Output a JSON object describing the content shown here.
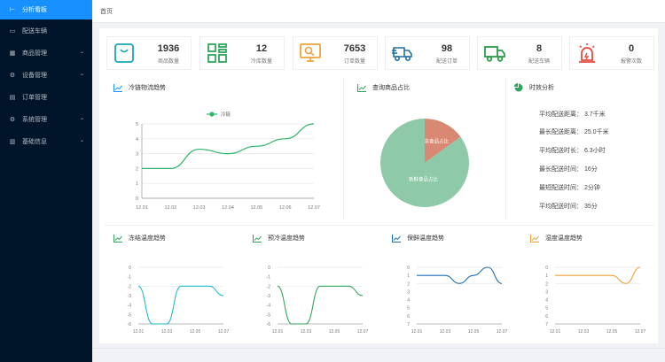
{
  "sidebar": {
    "items": [
      {
        "label": "分析看板",
        "icon": "dashboard-icon"
      },
      {
        "label": "配送车辆",
        "icon": "truck-icon"
      },
      {
        "label": "商品管理",
        "icon": "goods-icon",
        "expandable": true
      },
      {
        "label": "设备管理",
        "icon": "device-icon",
        "expandable": true
      },
      {
        "label": "订单管理",
        "icon": "order-icon"
      },
      {
        "label": "系统管理",
        "icon": "system-icon",
        "expandable": true
      },
      {
        "label": "基础信息",
        "icon": "info-icon",
        "expandable": true
      }
    ]
  },
  "breadcrumb": "首页",
  "stats": [
    {
      "value": "1936",
      "label": "商品数量",
      "icon": "shopping-bag-icon",
      "color": "#1aa7b8"
    },
    {
      "value": "12",
      "label": "冷库数量",
      "icon": "grid-icon",
      "color": "#2fa65c"
    },
    {
      "value": "7653",
      "label": "订单数量",
      "icon": "monitor-icon",
      "color": "#f0a23b"
    },
    {
      "value": "98",
      "label": "配送订单",
      "icon": "delivery-truck-icon",
      "color": "#1e6fa8"
    },
    {
      "value": "8",
      "label": "配送车辆",
      "icon": "lorry-icon",
      "color": "#2c9d47"
    },
    {
      "value": "0",
      "label": "报警次数",
      "icon": "alarm-icon",
      "color": "#e8493b"
    }
  ],
  "panels": {
    "main_chart_title": "冷链物流趋势",
    "pie_title": "查询商品占比",
    "analysis_title": "时效分析",
    "small_chart_titles": [
      "冻结温度趋势",
      "预冷温度趋势",
      "保鲜温度趋势",
      "湿度温度趋势"
    ]
  },
  "analysis": [
    "平均配送距离：  3.7千米",
    "最长配送距离：  25.0千米",
    "平均配送时长：  6.3小时",
    "最长配送时间：  16分",
    "最短配送时间：  2分钟",
    "平均配送时间：  35分"
  ],
  "colors": {
    "sidebar_bg": "#001529",
    "active": "#1890ff",
    "pie_major": "#8ec9a9",
    "pie_minor": "#d98873"
  },
  "chart_data": [
    {
      "type": "line",
      "title": "冷链物流趋势",
      "legend": [
        "冷链"
      ],
      "legend_position": "top-center",
      "categories": [
        "12.01",
        "12.02",
        "12.03",
        "12.04",
        "12.05",
        "12.06",
        "12.07"
      ],
      "series": [
        {
          "name": "冷链",
          "values": [
            2,
            2,
            3.3,
            3,
            3.5,
            4,
            5
          ],
          "color": "#2ab866"
        }
      ],
      "ylim": [
        0,
        5
      ],
      "yticks": [
        "0",
        "1",
        "2",
        "3",
        "4",
        "5"
      ],
      "grid": true
    },
    {
      "type": "pie",
      "title": "查询商品占比",
      "labels": [
        "冷冻食品占比",
        "新鲜食品占比"
      ],
      "values": [
        15,
        85
      ],
      "colors": [
        "#d98873",
        "#8ec9a9"
      ]
    },
    {
      "type": "line",
      "title": "冻结温度趋势",
      "categories": [
        "12.01",
        "12.03",
        "12.05",
        "12.07"
      ],
      "x": [
        0,
        1,
        2,
        3,
        4,
        5,
        6
      ],
      "series": [
        {
          "values": [
            -2,
            -6,
            -6,
            -2,
            -2,
            -2,
            -3
          ],
          "color": "#1ebcd4"
        }
      ],
      "ylim": [
        -6,
        0
      ],
      "yticks": [
        "0",
        "-1",
        "-2",
        "-3",
        "-4",
        "-5",
        "-6"
      ]
    },
    {
      "type": "line",
      "title": "预冷温度趋势",
      "categories": [
        "12.01",
        "12.03",
        "12.05",
        "12.07"
      ],
      "x": [
        0,
        1,
        2,
        3,
        4,
        5,
        6
      ],
      "series": [
        {
          "values": [
            -2,
            -6,
            -6,
            -2,
            -2,
            -2,
            -3
          ],
          "color": "#2fa65c"
        }
      ],
      "ylim": [
        -6,
        0
      ],
      "yticks": [
        "0",
        "-1",
        "-2",
        "-3",
        "-4",
        "-5",
        "-6"
      ]
    },
    {
      "type": "line",
      "title": "保鲜温度趋势",
      "categories": [
        "12.01",
        "12.03",
        "12.05",
        "12.07"
      ],
      "x": [
        0,
        1,
        2,
        3,
        4,
        5,
        6
      ],
      "series": [
        {
          "values": [
            1,
            1,
            1,
            2,
            1,
            0,
            2
          ],
          "color": "#1f6fb5"
        }
      ],
      "ylim": [
        0,
        7
      ],
      "yticks": [
        "0",
        "1",
        "2",
        "3",
        "4",
        "5",
        "6",
        "7"
      ]
    },
    {
      "type": "line",
      "title": "湿度温度趋势",
      "categories": [
        "12.01",
        "12.03",
        "12.05",
        "12.07"
      ],
      "x": [
        0,
        1,
        2,
        3,
        4,
        5,
        6
      ],
      "series": [
        {
          "values": [
            1,
            1,
            1,
            1,
            1,
            2,
            0
          ],
          "color": "#f0a23b"
        }
      ],
      "ylim": [
        0,
        7
      ],
      "yticks": [
        "0",
        "1",
        "2",
        "3",
        "4",
        "5",
        "6",
        "7"
      ]
    }
  ]
}
